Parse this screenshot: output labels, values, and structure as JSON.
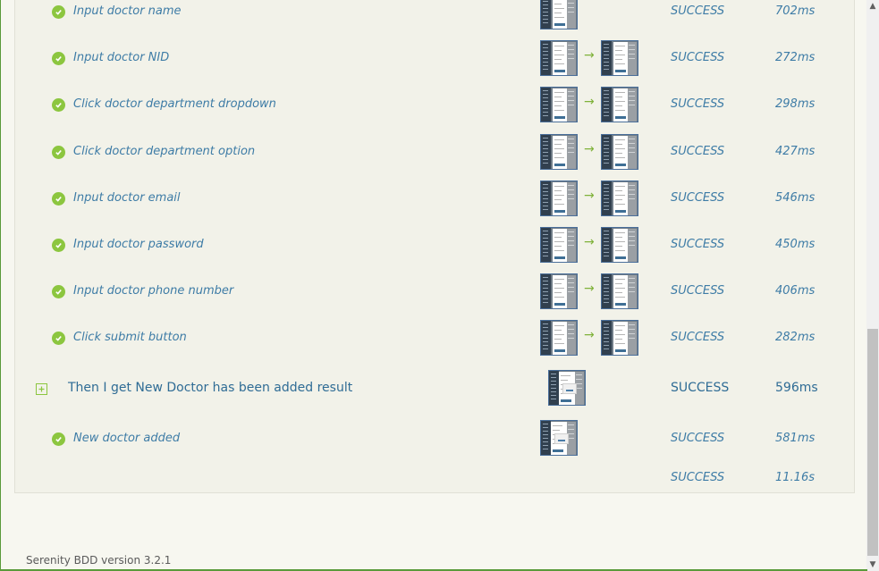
{
  "steps": [
    {
      "label": "Input doctor name",
      "screenshots": 1,
      "result": "SUCCESS",
      "duration": "702ms"
    },
    {
      "label": "Input doctor NID",
      "screenshots": 2,
      "result": "SUCCESS",
      "duration": "272ms"
    },
    {
      "label": "Click doctor department dropdown",
      "screenshots": 2,
      "result": "SUCCESS",
      "duration": "298ms"
    },
    {
      "label": "Click doctor department option",
      "screenshots": 2,
      "result": "SUCCESS",
      "duration": "427ms"
    },
    {
      "label": "Input doctor email",
      "screenshots": 2,
      "result": "SUCCESS",
      "duration": "546ms"
    },
    {
      "label": "Input doctor password",
      "screenshots": 2,
      "result": "SUCCESS",
      "duration": "450ms"
    },
    {
      "label": "Input doctor phone number",
      "screenshots": 2,
      "result": "SUCCESS",
      "duration": "406ms"
    },
    {
      "label": "Click submit button",
      "screenshots": 2,
      "result": "SUCCESS",
      "duration": "282ms"
    }
  ],
  "outcome": {
    "label": "Then I get New Doctor has been added result",
    "result": "SUCCESS",
    "duration": "596ms",
    "substep": {
      "label": "New doctor added",
      "result": "SUCCESS",
      "duration": "581ms"
    }
  },
  "total": {
    "result": "SUCCESS",
    "duration": "11.16s"
  },
  "footer": {
    "version_text": "Serenity BDD version 3.2.1"
  },
  "icons": {
    "step_status": "check-circle-icon",
    "expand": "plus-square-icon",
    "transition": "arrow-right-icon"
  },
  "colors": {
    "accent_green": "#8cc63f",
    "link_blue": "#3e7ca6"
  }
}
